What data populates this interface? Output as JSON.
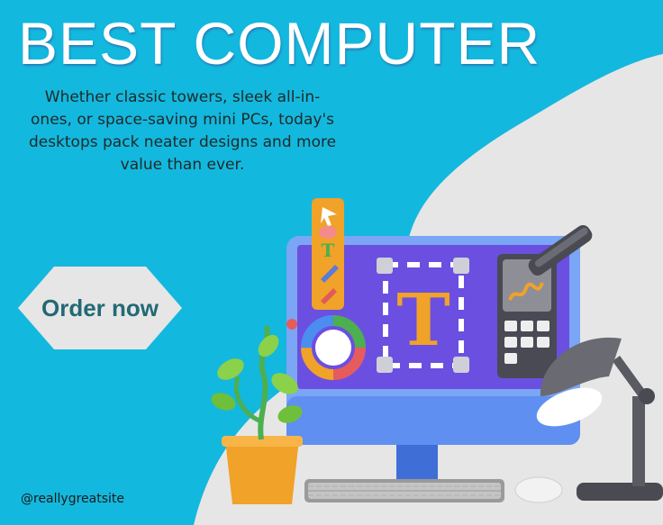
{
  "poster": {
    "title": "BEST COMPUTER",
    "description": "Whether classic towers, sleek all-in-ones, or space-saving mini PCs, today's desktops pack neater designs and more value than ever.",
    "cta_label": "Order now",
    "handle": "@reallygreatsite",
    "editor_glyph": "T"
  },
  "colors": {
    "background": "#13b8de",
    "blob": "#e6e6e6",
    "cta_text": "#236975",
    "screen": "#6b4fe0",
    "monitor": "#7aa6f5"
  }
}
